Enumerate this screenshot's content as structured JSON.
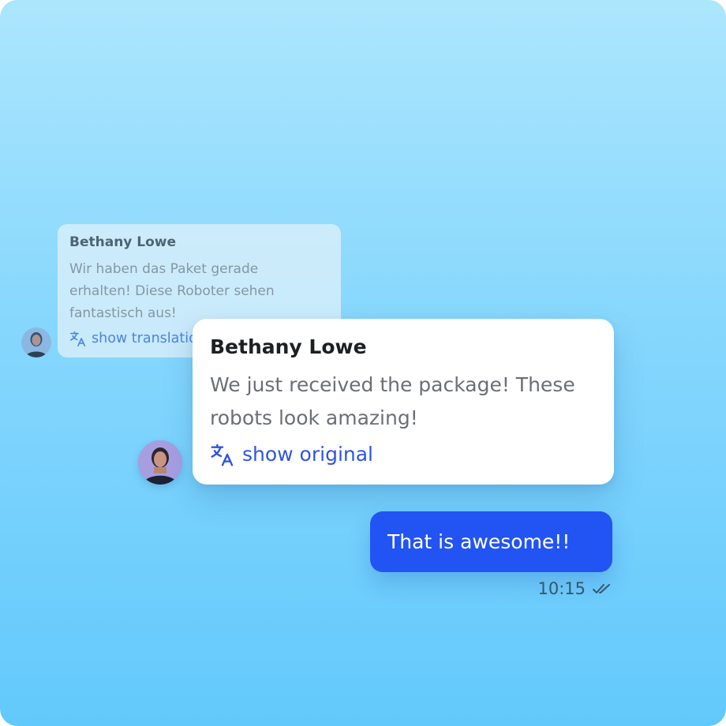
{
  "background_message": {
    "sender": "Bethany Lowe",
    "text": "Wir haben das Paket gerade erhalten! Diese Roboter sehen fantastisch aus!",
    "translate_link": "show translation",
    "avatar_icon": "person-avatar-icon",
    "translate_icon": "translate-icon"
  },
  "translated_message": {
    "sender": "Bethany Lowe",
    "text": "We just received the package! These robots look amazing!",
    "original_link": "show original",
    "avatar_icon": "person-avatar-icon",
    "translate_icon": "translate-icon"
  },
  "outgoing_message": {
    "text": "That is awesome!!",
    "time": "10:15",
    "status_icon": "double-check-icon"
  },
  "colors": {
    "accent": "#2254f4",
    "link": "#2f54e4",
    "background_top": "#ace6fd",
    "background_bottom": "#62c9fc"
  }
}
